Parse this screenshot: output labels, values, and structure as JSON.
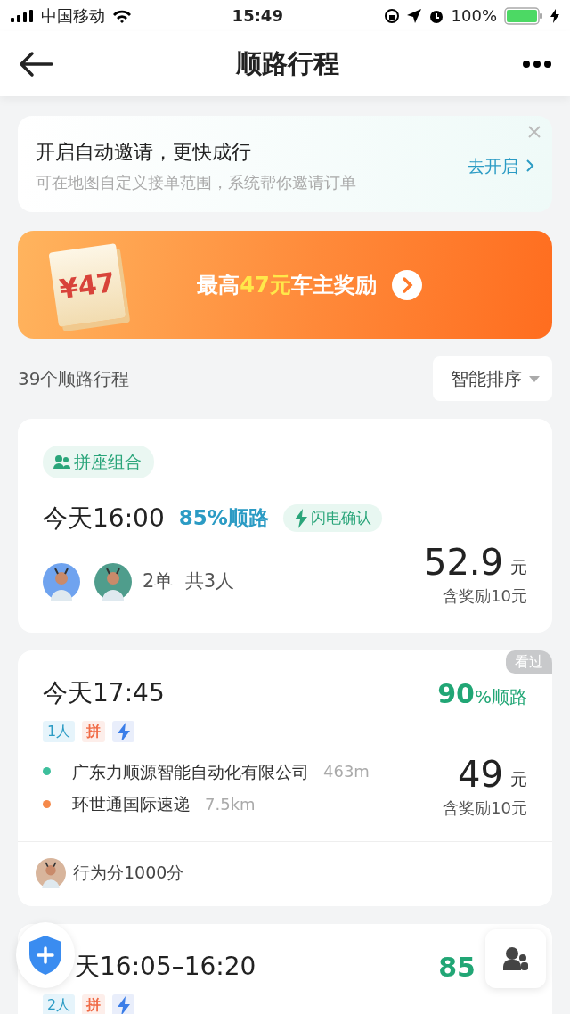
{
  "status_bar": {
    "carrier": "中国移动",
    "time": "15:49",
    "battery": "100%"
  },
  "nav": {
    "title": "顺路行程"
  },
  "invite_banner": {
    "title": "开启自动邀请，更快成行",
    "subtitle": "可在地图自定义接单范围，系统帮你邀请订单",
    "action": "去开启"
  },
  "promo": {
    "ticket_amount": "¥47",
    "text": "最高",
    "highlight": "47元",
    "text_end": "车主奖励"
  },
  "list_header": {
    "count": "39个顺路行程",
    "sort": "智能排序"
  },
  "trips": [
    {
      "kind": "combo",
      "tag": "拼座组合",
      "time": "今天16:00",
      "match": "85%顺路",
      "badge": "闪电确认",
      "summary": "2单  共3人",
      "price": "52.9",
      "unit": "元",
      "reward": "含奖励10元"
    },
    {
      "kind": "single",
      "seen": "看过",
      "time": "今天17:45",
      "match_number": "90",
      "match_suffix": "%顺路",
      "tags": [
        {
          "kind": "count",
          "text": "1人"
        },
        {
          "kind": "carpool",
          "text": "拼"
        },
        {
          "kind": "flash"
        }
      ],
      "stops": [
        {
          "name": "广东力顺源智能自动化有限公司",
          "distance": "463m",
          "color": "#3dbf9c"
        },
        {
          "name": "环世通国际速递",
          "distance": "7.5km",
          "color": "#f5894a"
        }
      ],
      "price": "49",
      "unit": "元",
      "reward": "含奖励10元",
      "footer": "行为分1000分"
    },
    {
      "kind": "single",
      "time": "天16:05–16:20",
      "match_number": "85",
      "tags": [
        {
          "kind": "count",
          "text": "2人"
        },
        {
          "kind": "carpool",
          "text": "拼"
        },
        {
          "kind": "flash"
        }
      ]
    }
  ]
}
